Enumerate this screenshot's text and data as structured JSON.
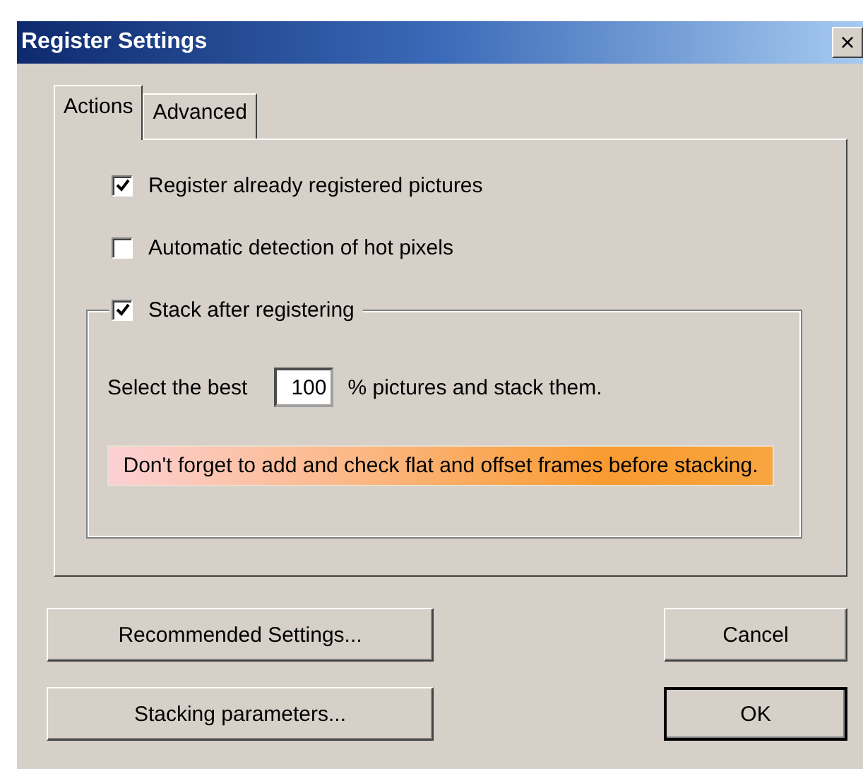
{
  "window": {
    "title": "Register Settings",
    "close": "×"
  },
  "tabs": [
    {
      "label": "Actions",
      "selected": true
    },
    {
      "label": "Advanced",
      "selected": false
    }
  ],
  "options": [
    {
      "label": "Register already registered pictures",
      "checked": true
    },
    {
      "label": "Automatic detection of hot pixels",
      "checked": false
    }
  ],
  "stack_group": {
    "label": "Stack after registering",
    "checked": true,
    "select_prefix": "Select the best",
    "percent_value": "100",
    "select_suffix": "% pictures and stack them.",
    "notice": "Don't forget to add and check flat and offset frames before stacking."
  },
  "buttons": [
    {
      "label": "Recommended Settings...",
      "default": false
    },
    {
      "label": "Cancel",
      "default": false
    },
    {
      "label": "Stacking parameters...",
      "default": false
    },
    {
      "label": "OK",
      "default": true
    }
  ]
}
